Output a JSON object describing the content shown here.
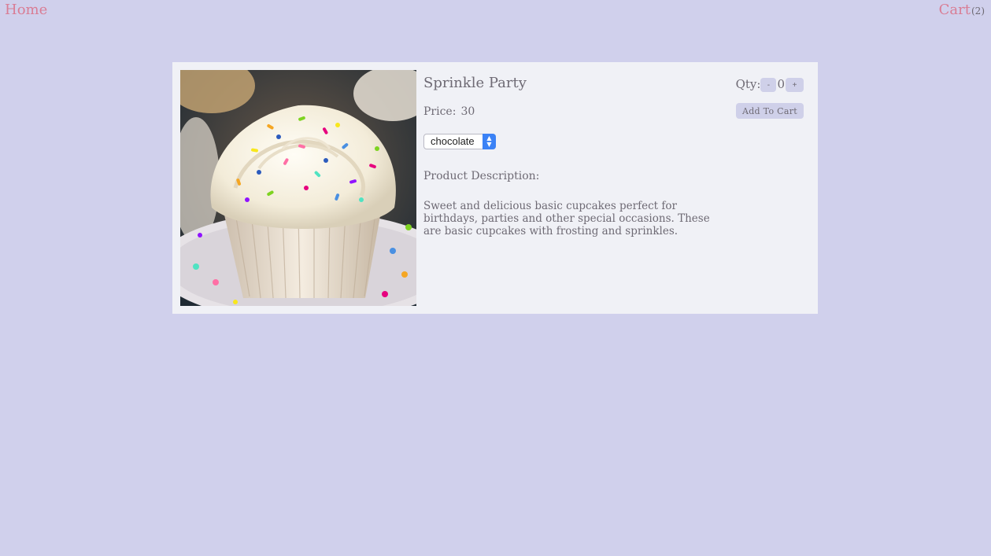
{
  "nav": {
    "home_label": "Home",
    "cart_label": "Cart",
    "cart_count": "(2)"
  },
  "product": {
    "title": "Sprinkle Party",
    "price_label": "Price:",
    "price_value": "30",
    "flavor_selected": "chocolate",
    "description_label": "Product Description:",
    "description": "Sweet and delicious basic cupcakes perfect for birthdays, parties and other special occasions. These are basic cupcakes with frosting and sprinkles."
  },
  "cart_controls": {
    "qty_label": "Qty:",
    "decrement_label": "-",
    "qty_value": "0",
    "increment_label": "+",
    "add_to_cart_label": "Add To Cart"
  },
  "colors": {
    "page_bg": "#d0d0ec",
    "card_bg": "#f0f1f6",
    "link_pink": "#d97d95",
    "text_gray": "#6e6a74",
    "button_bg": "#cfd0e9",
    "select_accent": "#3b82f6"
  }
}
